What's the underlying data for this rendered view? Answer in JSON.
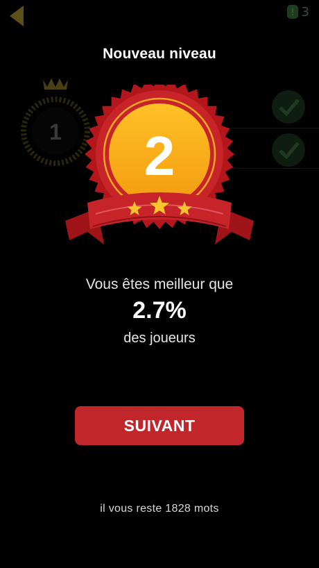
{
  "header": {
    "hint_count": "3"
  },
  "background": {
    "level_number": "1"
  },
  "modal": {
    "title": "Nouveau niveau",
    "new_level": "2",
    "message_line1": "Vous êtes meilleur que",
    "message_percent": "2.7%",
    "message_line3": "des joueurs",
    "next_button_label": "SUIVANT",
    "remaining_words": "il vous reste 1828 mots"
  },
  "colors": {
    "accent_red": "#c1262b",
    "badge_gold": "#fbb11b",
    "star_gold": "#f6c42d"
  }
}
